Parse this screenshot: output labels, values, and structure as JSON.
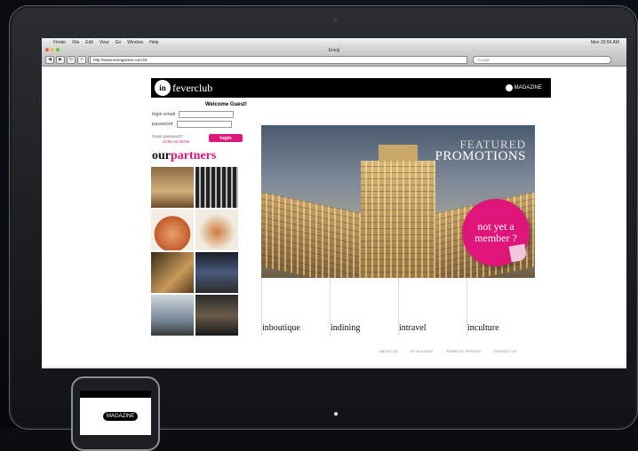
{
  "mac_menubar": {
    "apple": "",
    "items": [
      "Finder",
      "File",
      "Edit",
      "View",
      "Go",
      "Window",
      "Help"
    ],
    "clock": "Mon 20:56 AM"
  },
  "browser": {
    "title": "Emoji",
    "url": "http://www.inmagazine.com.hk",
    "search_placeholder": "Google"
  },
  "site": {
    "logo_mark": "in",
    "logo_text": "feverclub",
    "header_magazine": "MAGAZINE",
    "welcome": "Welcome Guest!",
    "login": {
      "email_label": "login email",
      "password_label": "password",
      "forgot": "forgot password?",
      "join": "JOIN US NOW",
      "button": "login"
    },
    "partners_prefix": "our",
    "partners_suffix": "partners",
    "partner_tiles": [
      "tile-1",
      "tile-2",
      "tile-3",
      "tile-4",
      "tile-5",
      "tile-6",
      "tile-7",
      "tile-8"
    ],
    "featured_line1": "FEATURED",
    "featured_line2": "PROMOTIONS",
    "categories": [
      "inboutique",
      "indining",
      "intravel",
      "inculture"
    ],
    "footer_links": [
      "ABOUT US",
      "MY ACCOUNT",
      "TERMS OF SERVICE",
      "CONTACT US"
    ],
    "sticker_line1": "not yet a",
    "sticker_line2": "member ?"
  },
  "iphone": {
    "logo_text": "MAGAZINE"
  }
}
